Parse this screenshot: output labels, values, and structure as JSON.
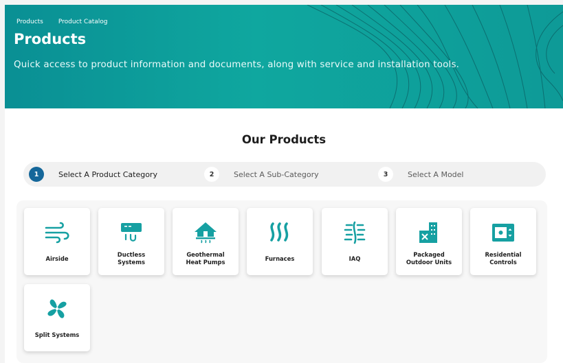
{
  "breadcrumb": [
    "Products",
    "Product Catalog"
  ],
  "hero": {
    "title": "Products",
    "subtitle": "Quick access to product information and documents, along with service and installation tools."
  },
  "section_title": "Our Products",
  "steps": [
    {
      "number": "1",
      "label": "Select A Product Category",
      "active": true
    },
    {
      "number": "2",
      "label": "Select A Sub-Category",
      "active": false
    },
    {
      "number": "3",
      "label": "Select A Model",
      "active": false
    }
  ],
  "categories": [
    {
      "label": "Airside",
      "icon": "wind-icon"
    },
    {
      "label": "Ductless\nSystems",
      "icon": "ductless-unit-icon"
    },
    {
      "label": "Geothermal\nHeat Pumps",
      "icon": "geothermal-house-icon"
    },
    {
      "label": "Furnaces",
      "icon": "heat-waves-icon"
    },
    {
      "label": "IAQ",
      "icon": "air-quality-icon"
    },
    {
      "label": "Packaged\nOutdoor Units",
      "icon": "packaged-unit-icon"
    },
    {
      "label": "Residential\nControls",
      "icon": "thermostat-icon"
    },
    {
      "label": "Split Systems",
      "icon": "fan-icon"
    }
  ],
  "colors": {
    "accent": "#16a0a2",
    "active_step": "#15679a",
    "hero_start": "#0a8f94",
    "hero_end": "#0e9a97"
  }
}
